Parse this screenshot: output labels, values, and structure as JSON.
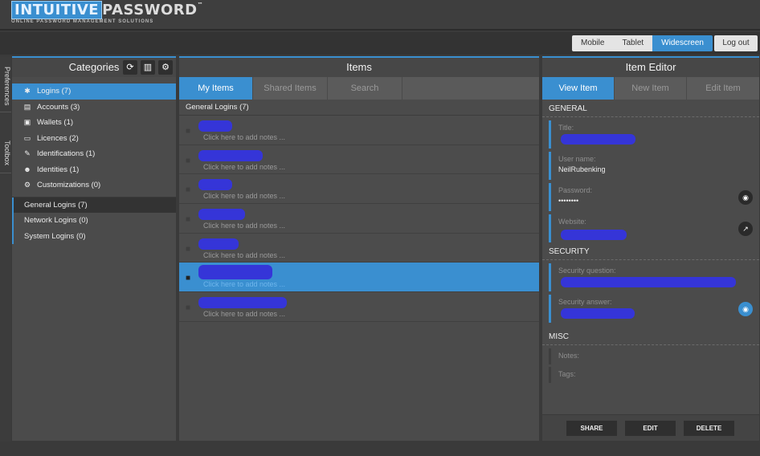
{
  "app": {
    "logo_main_a": "INTUITIVE",
    "logo_main_b": "PASSWORD",
    "logo_tm": "™",
    "logo_sub": "ONLINE PASSWORD MANAGEMENT SOLUTIONS"
  },
  "topbar": {
    "views": [
      "Mobile",
      "Tablet",
      "Widescreen"
    ],
    "active_view": "Widescreen",
    "logout": "Log out"
  },
  "sidetabs": [
    "Preferences",
    "Toolbox"
  ],
  "categories": {
    "title": "Categories",
    "header_icons": [
      "refresh-icon",
      "book-icon",
      "gear-icon"
    ],
    "items": [
      {
        "label": "Logins (7)",
        "icon": "asterisk-icon",
        "glyph": "✱",
        "selected": true
      },
      {
        "label": "Accounts (3)",
        "icon": "book-icon",
        "glyph": "▤"
      },
      {
        "label": "Wallets (1)",
        "icon": "wallet-icon",
        "glyph": "▣"
      },
      {
        "label": "Licences (2)",
        "icon": "card-icon",
        "glyph": "▭"
      },
      {
        "label": "Identifications (1)",
        "icon": "key-icon",
        "glyph": "✎"
      },
      {
        "label": "Identities (1)",
        "icon": "users-icon",
        "glyph": "☻"
      },
      {
        "label": "Customizations (0)",
        "icon": "cogs-icon",
        "glyph": "⚙"
      }
    ],
    "subcats": [
      {
        "label": "General Logins (7)",
        "selected": true
      },
      {
        "label": "Network Logins (0)"
      },
      {
        "label": "System Logins (0)"
      }
    ]
  },
  "items": {
    "title": "Items",
    "tabs": [
      "My Items",
      "Shared Items",
      "Search"
    ],
    "active_tab": "My Items",
    "group": "General Logins (7)",
    "note_placeholder": "Click here to add notes ...",
    "selected_index": 5
  },
  "editor": {
    "title": "Item Editor",
    "tabs": [
      "View Item",
      "New Item",
      "Edit Item"
    ],
    "active_tab": "View Item",
    "sections": {
      "general": "GENERAL",
      "security": "SECURITY",
      "misc": "MISC"
    },
    "fields": {
      "title_label": "Title:",
      "username_label": "User name:",
      "username_value": "NeilRubenking",
      "password_label": "Password:",
      "password_value": "••••••••",
      "website_label": "Website:",
      "secq_label": "Security question:",
      "seca_label": "Security answer:",
      "notes_label": "Notes:",
      "tags_label": "Tags:"
    },
    "actions": [
      "SHARE",
      "EDIT",
      "DELETE"
    ]
  },
  "colors": {
    "accent": "#3a8fd0",
    "redaction": "#3535d8"
  }
}
